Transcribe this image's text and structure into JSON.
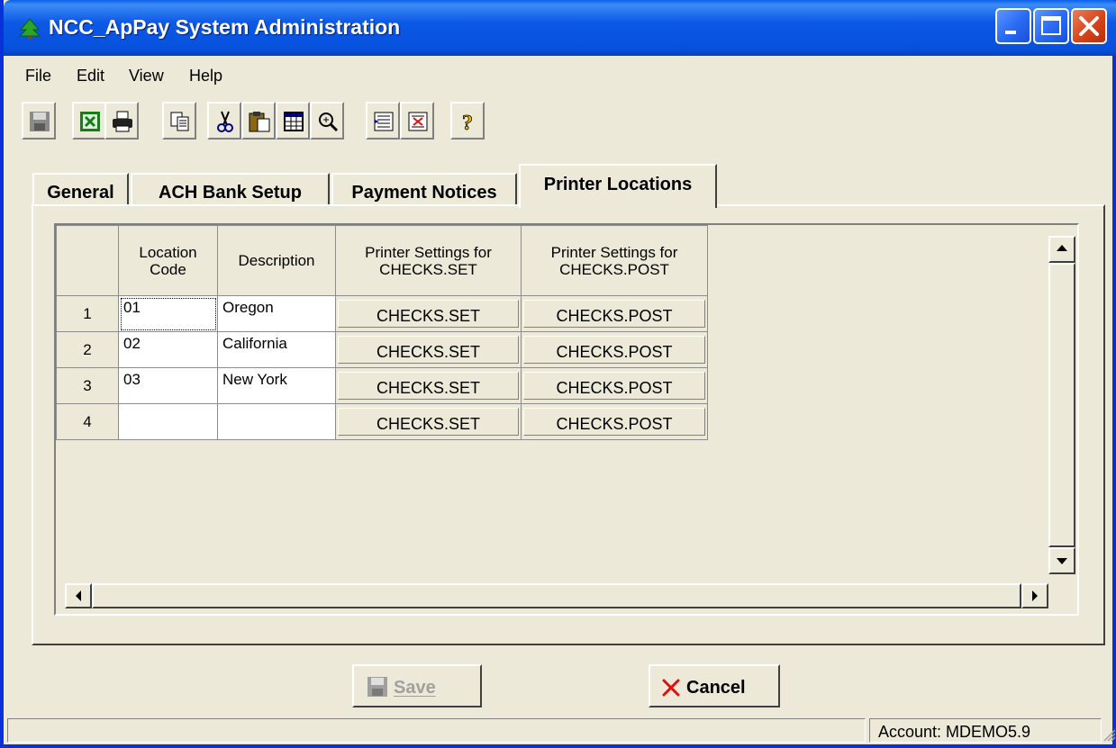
{
  "window": {
    "title": "NCC_ApPay System Administration"
  },
  "menu": [
    "File",
    "Edit",
    "View",
    "Help"
  ],
  "toolbar": {
    "icons": [
      "save-icon",
      "excel-icon",
      "print-icon",
      "copy-icon",
      "cut-icon",
      "paste-icon",
      "grid-icon",
      "zoom-icon",
      "insert-row-icon",
      "delete-row-icon",
      "help-icon"
    ]
  },
  "tabs": [
    "General",
    "ACH Bank Setup",
    "Payment Notices",
    "Printer Locations"
  ],
  "active_tab": "Printer Locations",
  "grid": {
    "headers": {
      "location_code": [
        "Location",
        "Code"
      ],
      "description": "Description",
      "printer_set": [
        "Printer Settings for",
        "CHECKS.SET"
      ],
      "printer_post": [
        "Printer Settings for",
        "CHECKS.POST"
      ]
    },
    "rows": [
      {
        "num": "1",
        "code": "01",
        "desc": "Oregon",
        "set": "CHECKS.SET",
        "post": "CHECKS.POST"
      },
      {
        "num": "2",
        "code": "02",
        "desc": "California",
        "set": "CHECKS.SET",
        "post": "CHECKS.POST"
      },
      {
        "num": "3",
        "code": "03",
        "desc": "New York",
        "set": "CHECKS.SET",
        "post": "CHECKS.POST"
      },
      {
        "num": "4",
        "code": "",
        "desc": "",
        "set": "CHECKS.SET",
        "post": "CHECKS.POST"
      }
    ]
  },
  "buttons": {
    "save": "Save",
    "cancel": "Cancel"
  },
  "status": {
    "account": "Account: MDEMO5.9"
  },
  "colors": {
    "titlebar": "#0554e3",
    "face": "#ece9d8",
    "cancel_x": "#e01010"
  }
}
